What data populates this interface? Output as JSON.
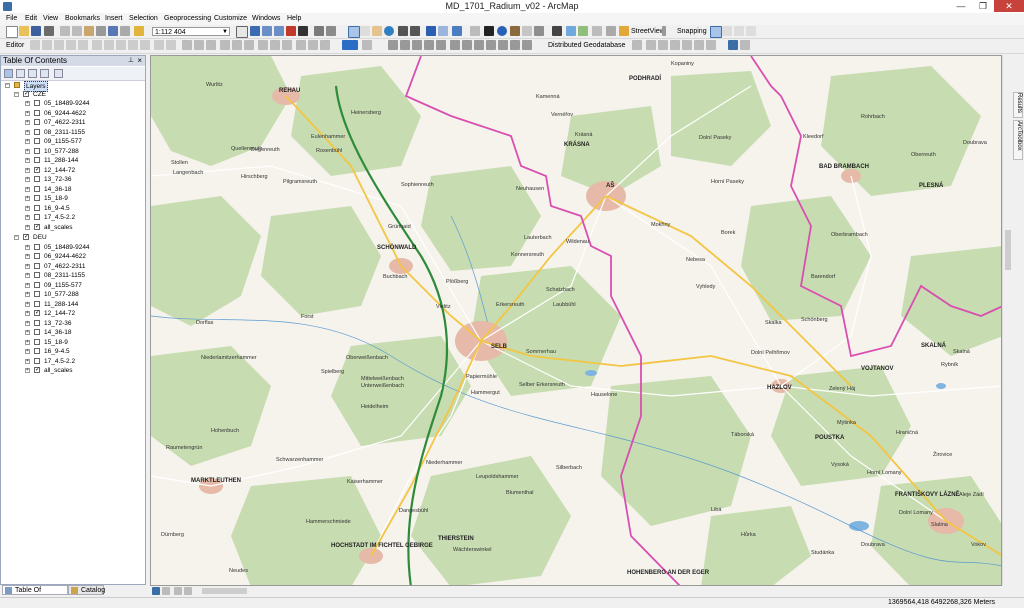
{
  "window": {
    "title": "MD_1701_Radium_v02 - ArcMap",
    "minimize": "—",
    "maximize": "❐",
    "close": "✕"
  },
  "menu": [
    "File",
    "Edit",
    "View",
    "Bookmarks",
    "Insert",
    "Selection",
    "Geoprocessing",
    "Customize",
    "Windows",
    "Help"
  ],
  "toolbar": {
    "scale_value": "1:112 404",
    "streetview_label": "StreetView",
    "snapping_label": "Snapping",
    "editor_label": "Editor",
    "geodatabase_label": "Distributed Geodatabase"
  },
  "toc": {
    "title": "Table Of Contents",
    "root_label": "Layers",
    "groups": [
      {
        "name": "CZE",
        "layers": [
          "05_18489-9244",
          "06_9244-4622",
          "07_4622-2311",
          "08_2311-1155",
          "09_1155-577",
          "10_577-288",
          "11_288-144",
          "12_144-72",
          "13_72-36",
          "14_36-18",
          "15_18-9",
          "16_9-4.5",
          "17_4.5-2.2",
          "all_scales"
        ]
      },
      {
        "name": "DEU",
        "layers": [
          "05_18489-9244",
          "06_9244-4622",
          "07_4622-2311",
          "08_2311-1155",
          "09_1155-577",
          "10_577-288",
          "11_288-144",
          "12_144-72",
          "13_72-36",
          "14_36-18",
          "15_18-9",
          "16_9-4.5",
          "17_4.5-2.2",
          "all_scales"
        ]
      }
    ],
    "checked_layers": [
      "12_144-72",
      "all_scales"
    ]
  },
  "bottom_tabs": [
    "Table Of Contents",
    "Catalog"
  ],
  "side_tabs": [
    "Results",
    "ArcToolbox"
  ],
  "status": {
    "coordinates": "1369564,418  6492268,326 Meters"
  },
  "map_labels": {
    "towns": [
      "REHAU",
      "SCHÖNWALD",
      "SELB",
      "AŠ",
      "KRÁSNA",
      "HAZLOV",
      "MARKTLEUTHEN",
      "HOCHSTADT IM FICHTEL GEBIRGE",
      "FRANTIŠKOVY LÁZNĚ",
      "BAD BRAMBACH",
      "POUSTKA",
      "SKALNÁ",
      "PODHRADÍ",
      "PLESNÁ",
      "VOJTANOV",
      "HOHENBERG AN DER EGER",
      "THIERSTEIN"
    ],
    "small": [
      "Wurlitz",
      "Heinersberg",
      "Eulenhammer",
      "Rosenbühl",
      "Pilgramsreuth",
      "Sophienreuth",
      "Grünhaid",
      "Neuhausen",
      "Lauterbach",
      "Wildenau",
      "Mokřiny",
      "Nebesa",
      "Vyhledy",
      "Plößberg",
      "Erkersreuth",
      "Schatzbach",
      "Spielberg",
      "Mittelweißenbach",
      "Unterweißenbach",
      "Papiermühle",
      "Hammergut",
      "Heidelheim",
      "Selber Erkersreuth",
      "Laubbühl",
      "Vielitz",
      "Buchbach",
      "Forst",
      "Dorflas",
      "Niederlamitzerhammer",
      "Oberweißenbach",
      "Kaiserhammer",
      "Niederhammer",
      "Leupoldshammer",
      "Blumenthal",
      "Silberbach",
      "Hohenbuch",
      "Raumetengrün",
      "Schwarzenhammer",
      "Dangesbühl",
      "Wächterswinkel",
      "Neudes",
      "Dürnberg",
      "Hammerschmiede",
      "Rohrbach",
      "Doubrava",
      "Krásná",
      "Dolní Paseky",
      "Horní Paseky",
      "Kopaniny",
      "Kamenná",
      "Vernéřov",
      "Oberreuth",
      "Borek",
      "Skalka",
      "Dolní Pelhřimov",
      "Zelený Háj",
      "Rybník",
      "Táborská",
      "Mýtinka",
      "Vysoká",
      "Hraničná",
      "Žirovice",
      "Horní Lomany",
      "Aleje Zádí",
      "Dolní Lomany",
      "Slatina",
      "Doubrava",
      "Vokov",
      "Libá",
      "Studánka",
      "Hůrka",
      "Skalná",
      "Oberbrambach",
      "Kleedorf",
      "Barendorf",
      "Schönberg",
      "Hauselone",
      "Sommerhau",
      "Quellenreuth",
      "Stollen",
      "Langenbach",
      "Hirschberg",
      "Degenreuth",
      "Konnersreuth"
    ]
  },
  "colors": {
    "border_line": "#d94fb1",
    "autobahn": "#2e8b3a",
    "main_road": "#f4c542",
    "forest": "#c7dcb0",
    "background": "#f5f3ec",
    "water": "#7fb3e0",
    "accent_toc": "#d4dbe7"
  }
}
